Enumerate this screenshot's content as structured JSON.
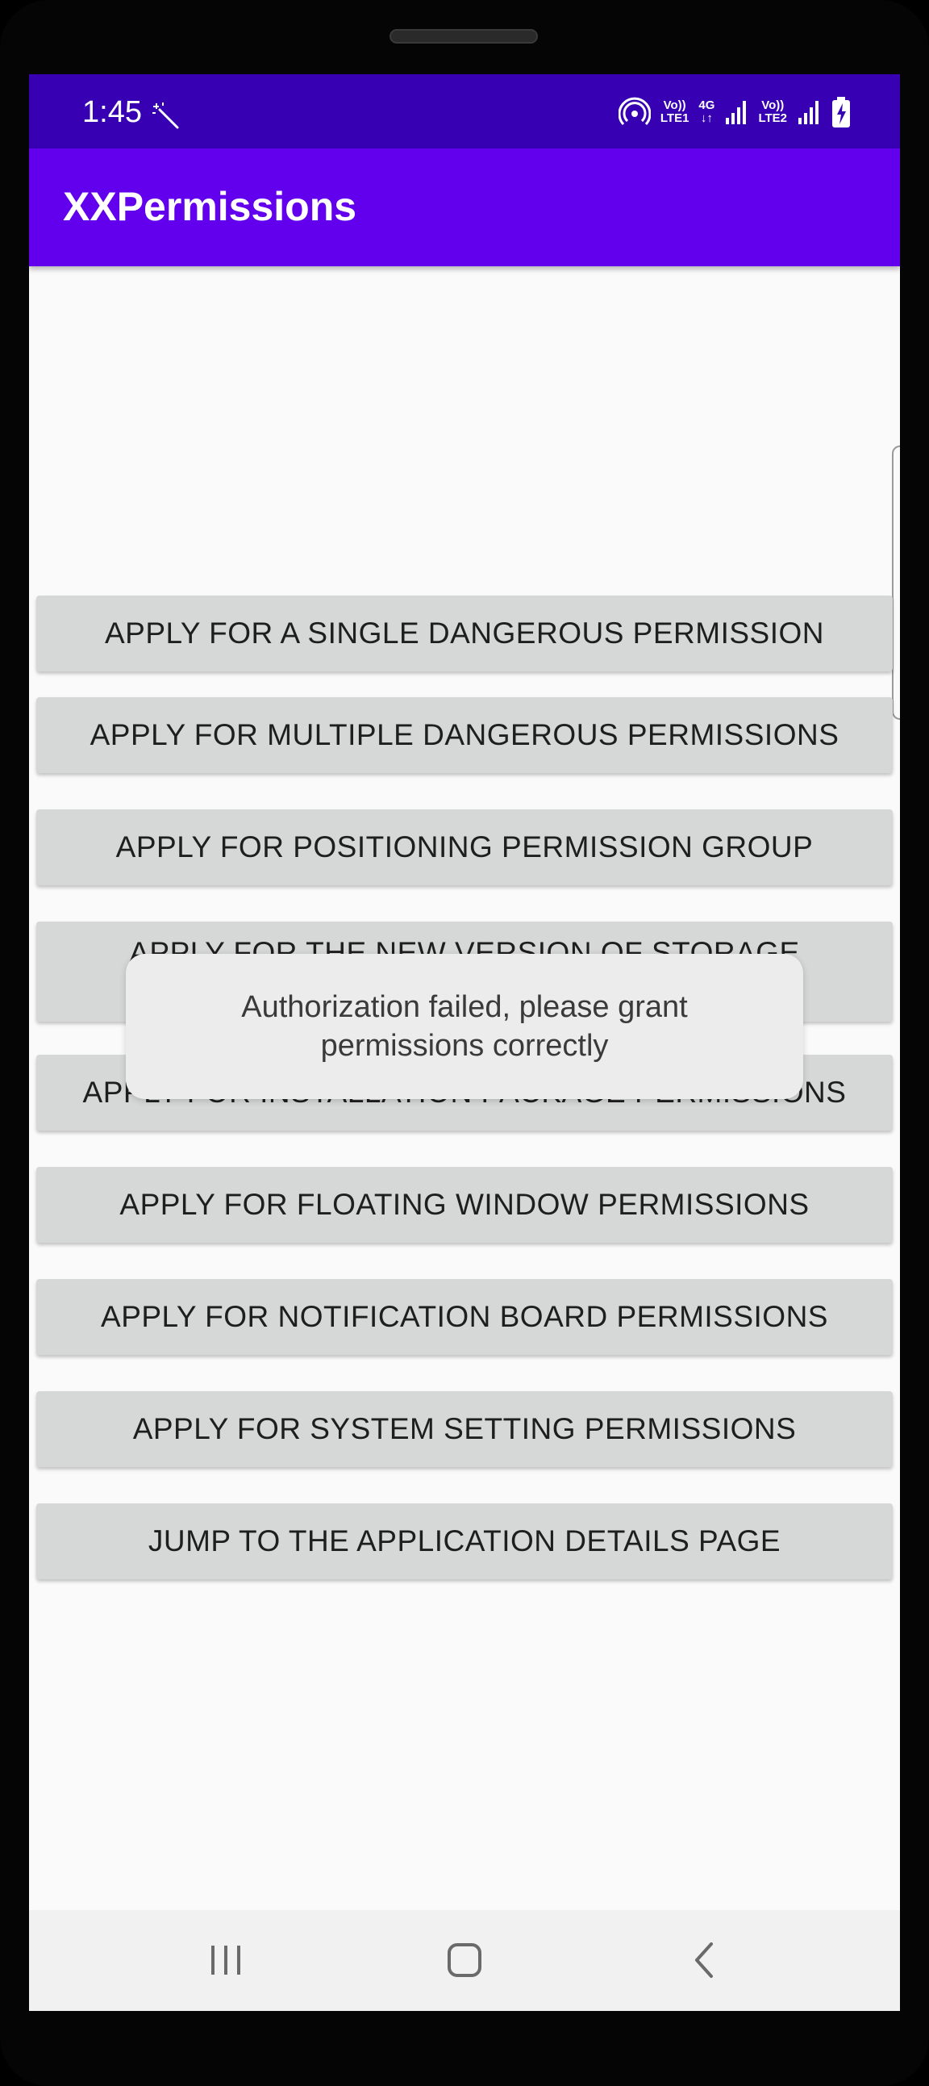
{
  "status_bar": {
    "time": "1:45",
    "net1_top": "Vo))",
    "net1_bottom": "LTE1",
    "net_4g": "4G",
    "net2_top": "Vo))",
    "net2_bottom": "LTE2"
  },
  "app_bar": {
    "title": "XXPermissions"
  },
  "buttons": [
    {
      "label": "APPLY FOR A SINGLE DANGEROUS PERMISSION"
    },
    {
      "label": "APPLY FOR MULTIPLE DANGEROUS PERMISSIONS"
    },
    {
      "label": "APPLY FOR POSITIONING PERMISSION GROUP"
    },
    {
      "label": "APPLY FOR THE NEW VERSION OF STORAGE"
    },
    {
      "label": "APPLY FOR INSTALLATION PACKAGE PERMISSIONS"
    },
    {
      "label": "APPLY FOR FLOATING WINDOW PERMISSIONS"
    },
    {
      "label": "APPLY FOR NOTIFICATION BOARD PERMISSIONS"
    },
    {
      "label": "APPLY FOR SYSTEM SETTING PERMISSIONS"
    },
    {
      "label": "JUMP TO THE APPLICATION DETAILS PAGE"
    }
  ],
  "toast": {
    "message": "Authorization failed, please grant permissions correctly"
  },
  "nav_bar": {
    "items": [
      "recent-apps-icon",
      "home-icon",
      "back-icon"
    ]
  },
  "colors": {
    "status_bar": "#3700b3",
    "app_bar": "#6200ee",
    "button_bg": "#d6d7d7",
    "screen_bg": "#fafafa"
  }
}
